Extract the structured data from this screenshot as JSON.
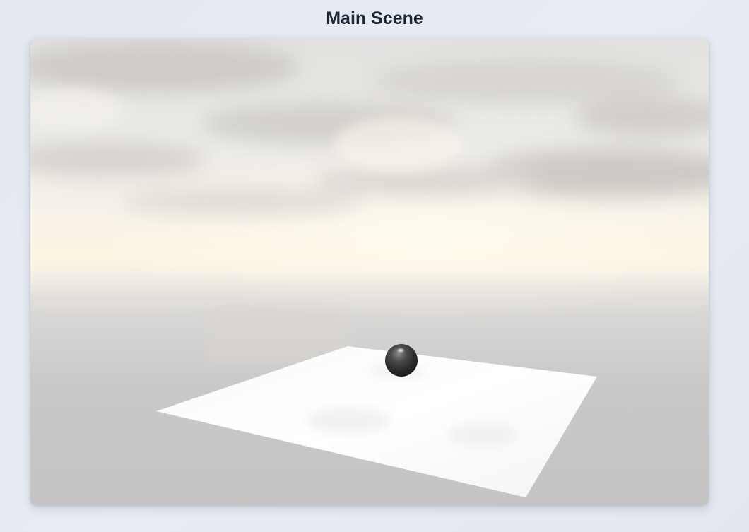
{
  "page": {
    "title": "Main Scene"
  },
  "scene": {
    "objects": [
      "sky",
      "cloud-layer",
      "horizon-glow",
      "ground",
      "ground-plane",
      "sphere"
    ],
    "colors": {
      "sky_top": "#dcdcdb",
      "horizon": "#fbf3e0",
      "ground": "#c4c2c1",
      "plane": "#ffffff",
      "sphere": "#2c2c2c"
    }
  }
}
